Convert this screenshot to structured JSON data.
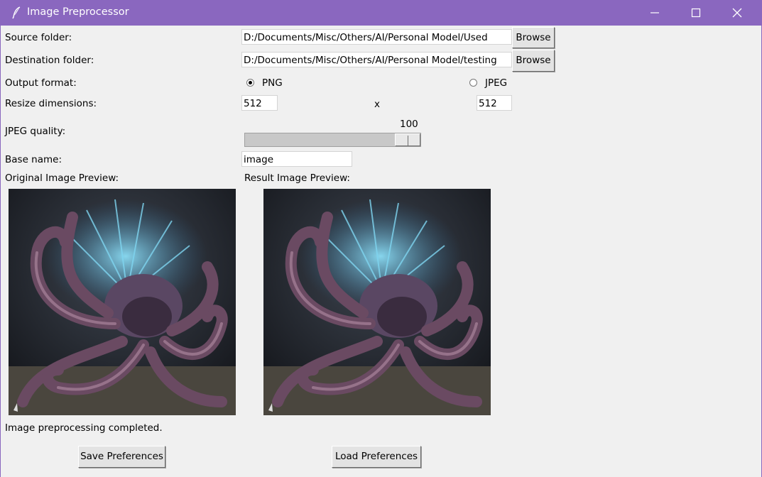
{
  "window": {
    "title": "Image Preprocessor",
    "icon": "feather-icon"
  },
  "form": {
    "source_label": "Source folder:",
    "source_value": "D:/Documents/Misc/Others/AI/Personal Model/Used",
    "source_browse": "Browse",
    "dest_label": "Destination folder:",
    "dest_value": "D:/Documents/Misc/Others/AI/Personal Model/testing",
    "dest_browse": "Browse",
    "format_label": "Output format:",
    "format_png": "PNG",
    "format_jpeg": "JPEG",
    "format_selected": "PNG",
    "resize_label": "Resize dimensions:",
    "width": "512",
    "x_sep": "x",
    "height": "512",
    "quality_label": "JPEG quality:",
    "quality_value": "100",
    "quality_fraction": 1.0,
    "basename_label": "Base name:",
    "basename_value": "image"
  },
  "previews": {
    "original_label": "Original Image Preview:",
    "result_label": "Result Image Preview:"
  },
  "status": "Image preprocessing completed.",
  "buttons": {
    "save": "Save Preferences",
    "load": "Load Preferences"
  },
  "colors": {
    "titlebar": "#8a67bf",
    "window_bg": "#f0f0f0"
  }
}
